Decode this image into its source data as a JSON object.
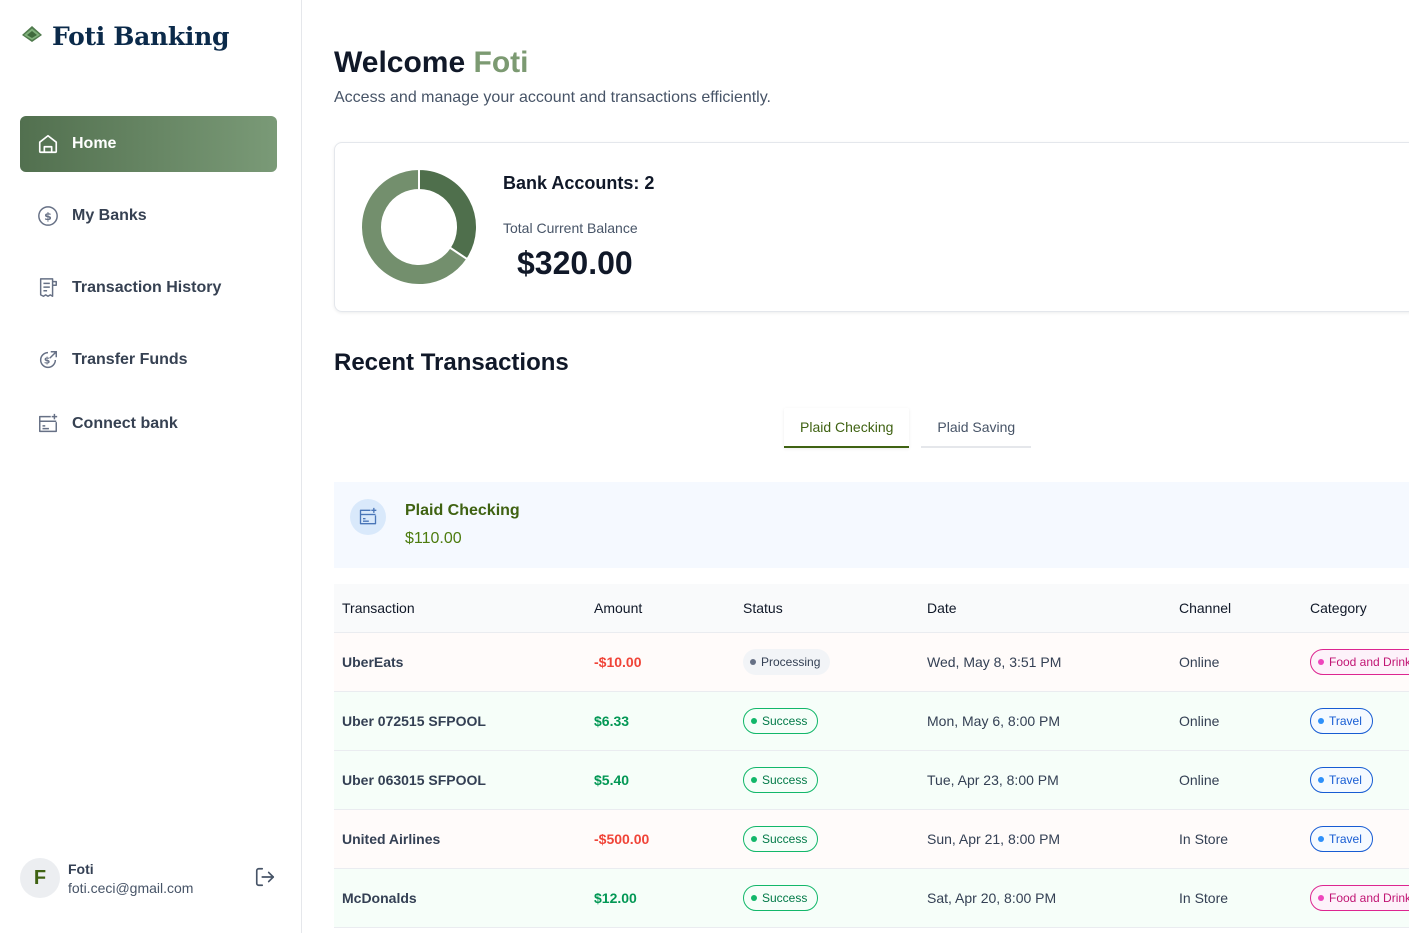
{
  "app": {
    "name": "Foti Banking",
    "logo_icon": "money-stack-icon"
  },
  "sidebar": {
    "items": [
      {
        "label": "Home",
        "icon": "home-icon",
        "active": true
      },
      {
        "label": "My Banks",
        "icon": "dollar-circle-icon"
      },
      {
        "label": "Transaction History",
        "icon": "receipt-icon"
      },
      {
        "label": "Transfer Funds",
        "icon": "money-send-icon"
      },
      {
        "label": "Connect bank",
        "icon": "connect-bank-icon"
      }
    ]
  },
  "user": {
    "initial": "F",
    "name": "Foti",
    "email": "foti.ceci@gmail.com"
  },
  "header": {
    "greeting": "Welcome",
    "name": "Foti",
    "subtitle": "Access and manage your account and transactions efficiently."
  },
  "balance": {
    "accounts_label": "Bank Accounts: 2",
    "total_label": "Total Current Balance",
    "total_value": "$320.00",
    "donut": {
      "segments": [
        110,
        210
      ],
      "colors": [
        "#4f6f4c",
        "#738f6d"
      ]
    }
  },
  "recent": {
    "title": "Recent Transactions",
    "tabs": [
      {
        "label": "Plaid Checking",
        "active": true
      },
      {
        "label": "Plaid Saving",
        "active": false
      }
    ],
    "account": {
      "name": "Plaid Checking",
      "balance": "$110.00"
    },
    "columns": [
      "Transaction",
      "Amount",
      "Status",
      "Date",
      "Channel",
      "Category"
    ],
    "rows": [
      {
        "name": "UberEats",
        "amount": "-$10.00",
        "type": "neg",
        "status": "Processing",
        "date": "Wed, May 8, 3:51 PM",
        "channel": "Online",
        "category": "Food and Drink",
        "cat": "food"
      },
      {
        "name": "Uber 072515 SFPOOL",
        "amount": "$6.33",
        "type": "pos",
        "status": "Success",
        "date": "Mon, May 6, 8:00 PM",
        "channel": "Online",
        "category": "Travel",
        "cat": "travel"
      },
      {
        "name": "Uber 063015 SFPOOL",
        "amount": "$5.40",
        "type": "pos",
        "status": "Success",
        "date": "Tue, Apr 23, 8:00 PM",
        "channel": "Online",
        "category": "Travel",
        "cat": "travel"
      },
      {
        "name": "United Airlines",
        "amount": "-$500.00",
        "type": "neg",
        "status": "Success",
        "date": "Sun, Apr 21, 8:00 PM",
        "channel": "In Store",
        "category": "Travel",
        "cat": "travel"
      },
      {
        "name": "McDonalds",
        "amount": "$12.00",
        "type": "pos",
        "status": "Success",
        "date": "Sat, Apr 20, 8:00 PM",
        "channel": "In Store",
        "category": "Food and Drink",
        "cat": "food"
      }
    ]
  }
}
